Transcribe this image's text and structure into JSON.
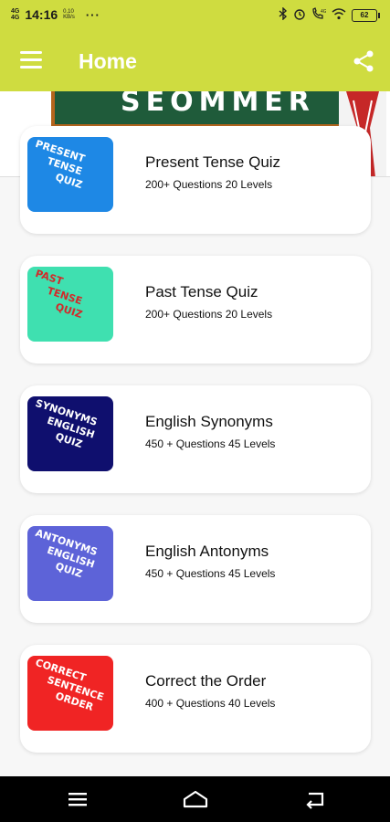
{
  "status_bar": {
    "network_1": "4G",
    "network_2": "4G",
    "time": "14:16",
    "speed_value": "0.10",
    "speed_unit": "KB/s",
    "more": "···",
    "battery": "62"
  },
  "app_bar": {
    "title": "Home"
  },
  "banner": {
    "board_text": "SEOMMER"
  },
  "quizzes": [
    {
      "title": "Present Tense Quiz",
      "subtitle": "200+ Questions 20 Levels",
      "thumb_words": [
        "Present",
        "Tense",
        "Quiz"
      ],
      "thumb_bg": "#1e88e5",
      "thumb_text_color": "#ffffff"
    },
    {
      "title": "Past Tense Quiz",
      "subtitle": "200+ Questions 20 Levels",
      "thumb_words": [
        "Past",
        "Tense",
        "Quiz"
      ],
      "thumb_bg": "#3fe0b0",
      "thumb_text_color": "#d12a2a"
    },
    {
      "title": "English Synonyms",
      "subtitle": "450 + Questions 45 Levels",
      "thumb_words": [
        "Synonyms",
        "English",
        "Quiz"
      ],
      "thumb_bg": "#0f0f6e",
      "thumb_text_color": "#ffffff"
    },
    {
      "title": "English Antonyms",
      "subtitle": "450 + Questions 45 Levels",
      "thumb_words": [
        "Antonyms",
        "English",
        "Quiz"
      ],
      "thumb_bg": "#5d63d8",
      "thumb_text_color": "#ffffff"
    },
    {
      "title": "Correct the Order",
      "subtitle": "400 + Questions 40 Levels",
      "thumb_words": [
        "Correct",
        "Sentence",
        "Order"
      ],
      "thumb_bg": "#f02424",
      "thumb_text_color": "#ffffff"
    }
  ],
  "icons": {
    "menu": "menu-icon",
    "share": "share-icon",
    "recents": "recents-icon",
    "home": "home-icon",
    "back": "back-icon"
  },
  "colors": {
    "accent": "#cfdc40"
  }
}
